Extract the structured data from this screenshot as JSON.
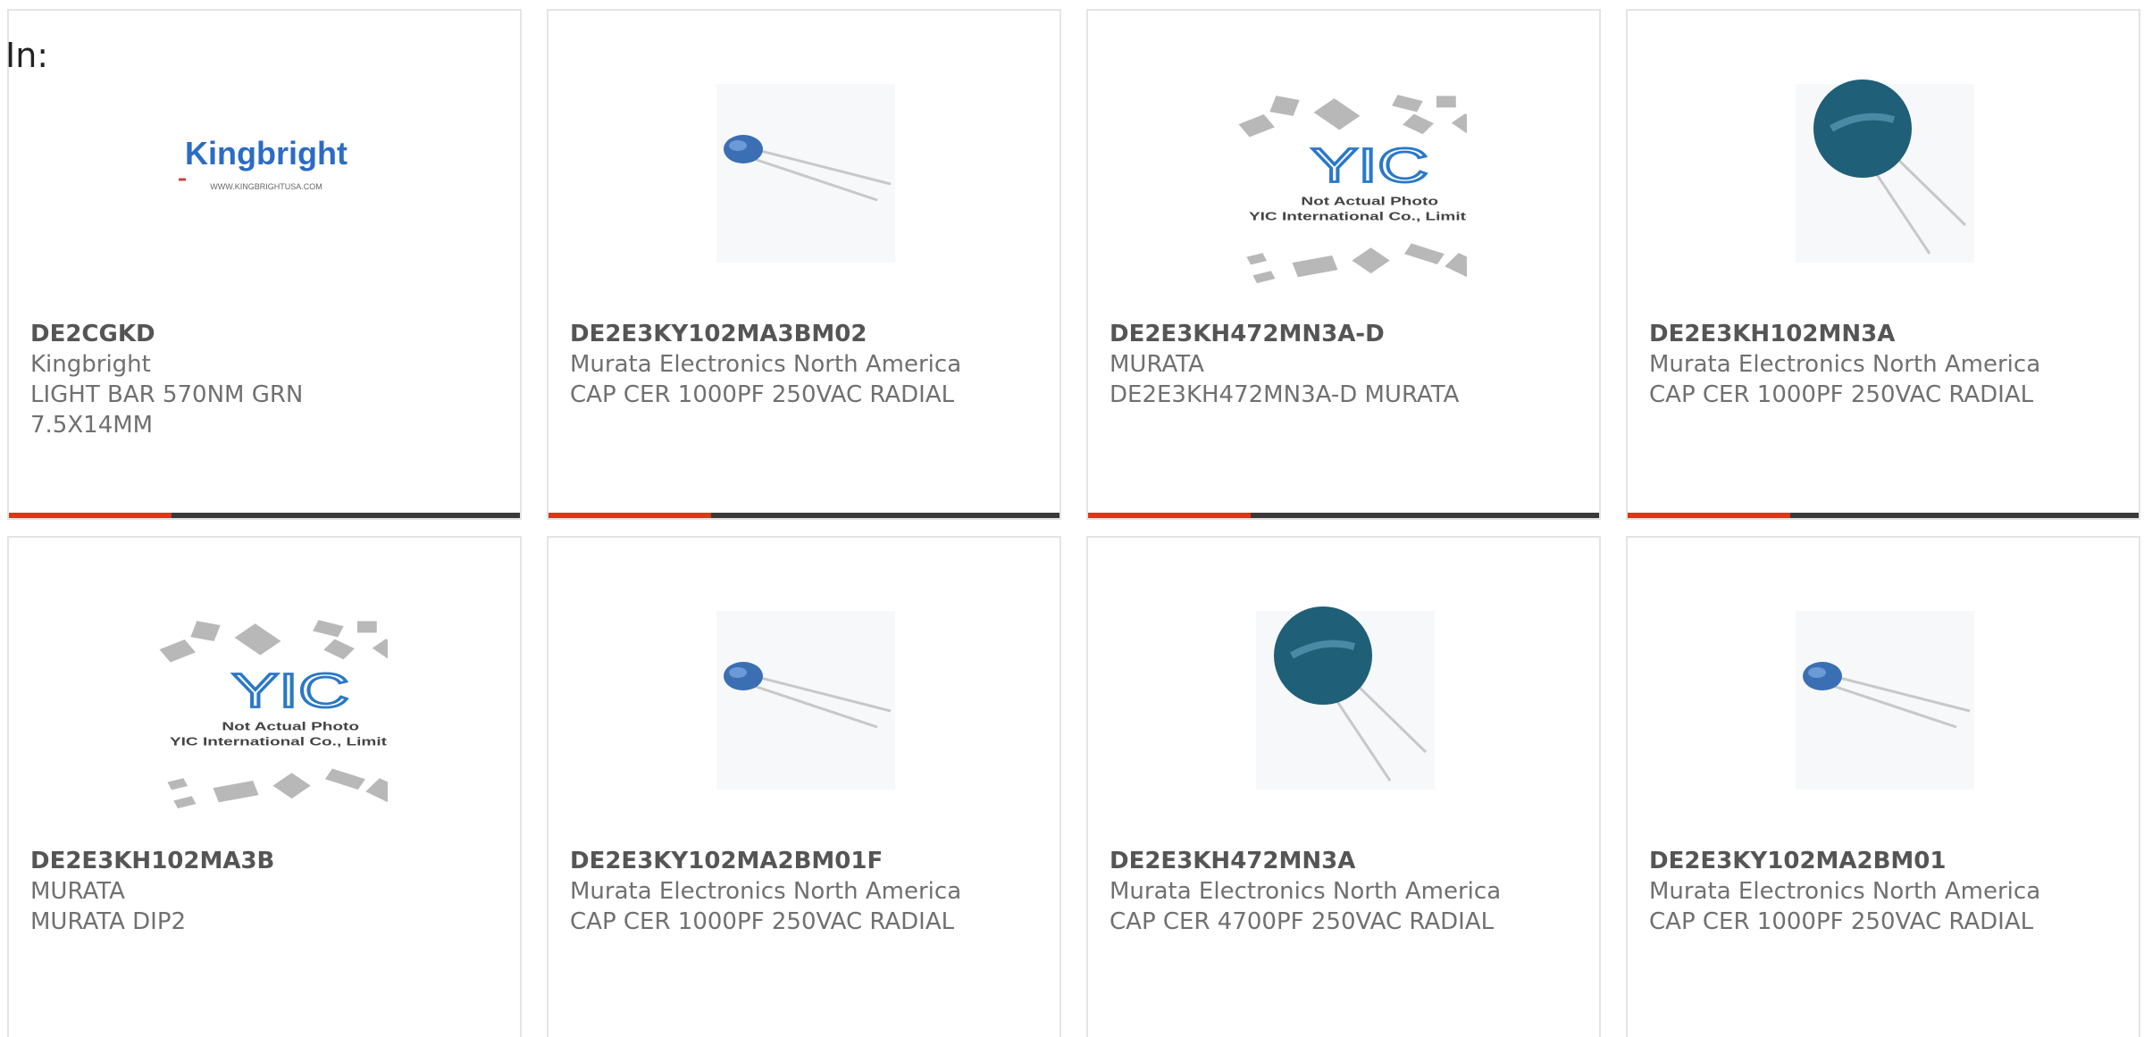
{
  "filter": {
    "in_label": "In:"
  },
  "products": [
    {
      "part_number": "DE2CGKD",
      "manufacturer": "Kingbright",
      "description_lines": [
        "LIGHT BAR 570NM GRN",
        "7.5X14MM"
      ],
      "image": "kingbright-logo",
      "logo_text": "Kingbright",
      "logo_url": "WWW.KINGBRIGHTUSA.COM"
    },
    {
      "part_number": "DE2E3KY102MA3BM02",
      "manufacturer": "Murata Electronics North America",
      "description_lines": [
        "CAP CER 1000PF 250VAC RADIAL"
      ],
      "image": "small-blue-disc-capacitor"
    },
    {
      "part_number": "DE2E3KH472MN3A-D",
      "manufacturer": "MURATA",
      "description_lines": [
        "DE2E3KH472MN3A-D MURATA"
      ],
      "image": "yic-placeholder",
      "placeholder_line1": "Not Actual Photo",
      "placeholder_line2": "YIC International Co., Limited."
    },
    {
      "part_number": "DE2E3KH102MN3A",
      "manufacturer": "Murata Electronics North America",
      "description_lines": [
        "CAP CER 1000PF 250VAC RADIAL"
      ],
      "image": "large-teal-disc-capacitor"
    },
    {
      "part_number": "DE2E3KH102MA3B",
      "manufacturer": "MURATA",
      "description_lines": [
        "MURATA DIP2"
      ],
      "image": "yic-placeholder",
      "placeholder_line1": "Not Actual Photo",
      "placeholder_line2": "YIC International Co., Limited."
    },
    {
      "part_number": "DE2E3KY102MA2BM01F",
      "manufacturer": "Murata Electronics North America",
      "description_lines": [
        "CAP CER 1000PF 250VAC RADIAL"
      ],
      "image": "small-blue-disc-capacitor"
    },
    {
      "part_number": "DE2E3KH472MN3A",
      "manufacturer": "Murata Electronics North America",
      "description_lines": [
        "CAP CER 4700PF 250VAC RADIAL"
      ],
      "image": "large-teal-disc-capacitor"
    },
    {
      "part_number": "DE2E3KY102MA2BM01",
      "manufacturer": "Murata Electronics North America",
      "description_lines": [
        "CAP CER 1000PF 250VAC RADIAL"
      ],
      "image": "small-blue-disc-capacitor"
    }
  ],
  "colors": {
    "accent": "#e0370f",
    "bar": "#3a3a3a",
    "text": "#707070",
    "border": "#e4e4e4"
  }
}
